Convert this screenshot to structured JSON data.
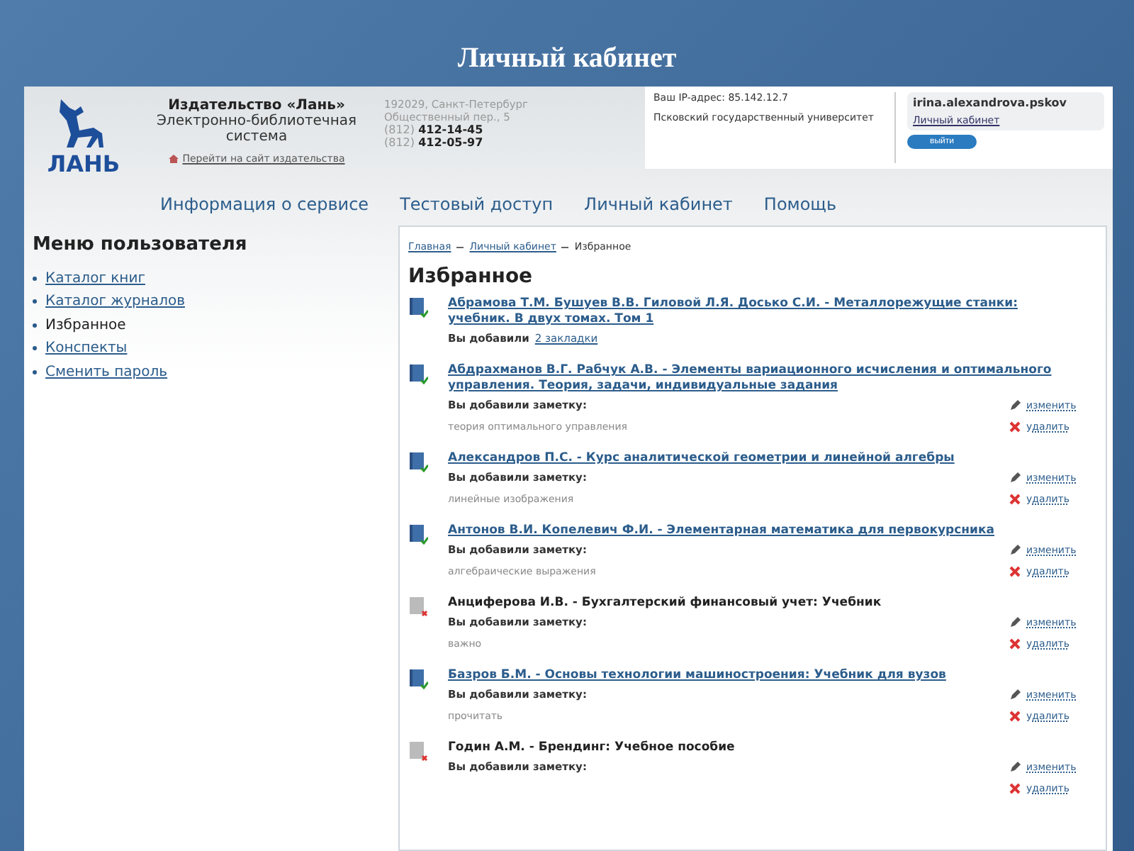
{
  "slide_title": "Личный кабинет",
  "header": {
    "logo_text": "ЛАНЬ",
    "publisher": "Издательство «Лань»",
    "subtitle": "Электронно-библиотечная система",
    "publisher_link": "Перейти на сайт издательства",
    "address": [
      "192029, Санкт-Петербург",
      "Общественный пер., 5"
    ],
    "phones": [
      {
        "code": "(812)",
        "number": "412-14-45"
      },
      {
        "code": "(812)",
        "number": "412-05-97"
      }
    ]
  },
  "account": {
    "ip": "Ваш IP-адрес: 85.142.12.7",
    "organization": "Псковский государственный университет",
    "user": "irina.alexandrova.pskov",
    "cabinet_link": "Личный кабинет",
    "logout": "выйти"
  },
  "nav": [
    "Информация о сервисе",
    "Тестовый доступ",
    "Личный кабинет",
    "Помощь"
  ],
  "menu": {
    "title": "Меню пользователя",
    "items": [
      {
        "label": "Каталог книг",
        "selected": false
      },
      {
        "label": "Каталог журналов",
        "selected": false
      },
      {
        "label": "Избранное",
        "selected": true
      },
      {
        "label": "Конспекты",
        "selected": false
      },
      {
        "label": "Сменить пароль",
        "selected": false
      }
    ]
  },
  "breadcrumbs": [
    {
      "label": "Главная",
      "link": true
    },
    {
      "label": "Личный кабинет",
      "link": true
    },
    {
      "label": "Избранное",
      "link": false
    }
  ],
  "page_title": "Избранное",
  "items": [
    {
      "kind": "available",
      "title": "Абрамова Т.М. Бушуев В.В. Гиловой Л.Я. Досько С.И. - Металлорежущие станки: учебник. В двух томах. Том 1",
      "added": "Вы добавили",
      "bookmarks": "2 закладки"
    },
    {
      "kind": "available",
      "title": "Абдрахманов В.Г. Рабчук А.В. - Элементы вариационного исчисления и оптимального управления. Теория, задачи, индивидуальные задания",
      "added": "Вы добавили заметку:",
      "note": "теория оптимального управления",
      "edit": "изменить",
      "delete": "удалить"
    },
    {
      "kind": "available",
      "title": "Александров П.С. - Курс аналитической геометрии и линейной алгебры",
      "added": "Вы добавили заметку:",
      "note": "линейные изображения",
      "edit": "изменить",
      "delete": "удалить"
    },
    {
      "kind": "available",
      "title": "Антонов В.И. Копелевич Ф.И. - Элементарная математика для первокурсника",
      "added": "Вы добавили заметку:",
      "note": "алгебраические выражения",
      "edit": "изменить",
      "delete": "удалить"
    },
    {
      "kind": "unavailable",
      "title": "Анциферова И.В. - Бухгалтерский финансовый учет: Учебник",
      "added": "Вы добавили заметку:",
      "note": "важно",
      "edit": "изменить",
      "delete": "удалить"
    },
    {
      "kind": "available",
      "title": "Базров Б.М. - Основы технологии машиностроения: Учебник для вузов",
      "added": "Вы добавили заметку:",
      "note": "прочитать",
      "edit": "изменить",
      "delete": "удалить"
    },
    {
      "kind": "unavailable",
      "title": "Годин А.М. - Брендинг: Учебное пособие",
      "added": "Вы добавили заметку:",
      "edit": "изменить",
      "delete": "удалить"
    }
  ]
}
